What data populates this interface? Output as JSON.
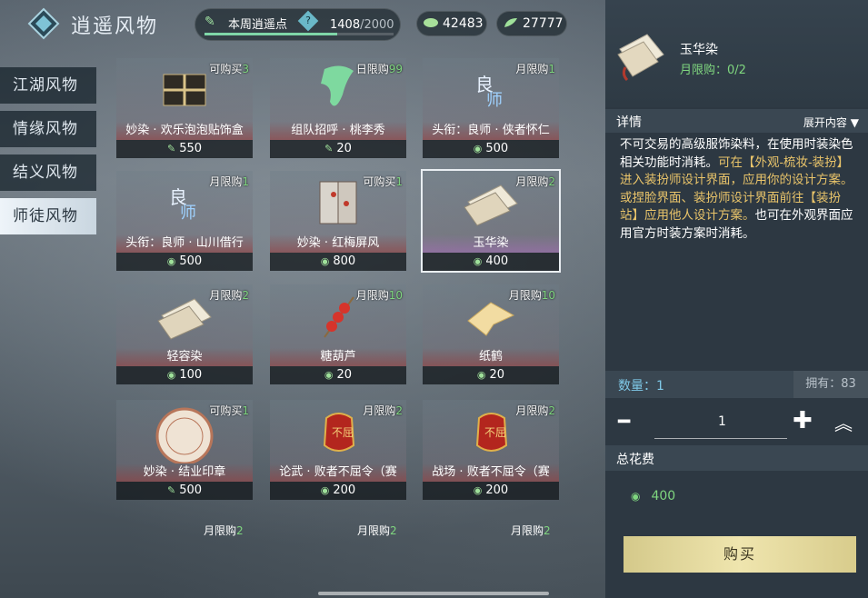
{
  "header": {
    "title": "逍遥风物",
    "weekly_label": "本周逍遥点",
    "help": "?",
    "weekly_current": "1408",
    "weekly_total": "/2000",
    "weekly_progress": 0.704,
    "currency_a": "42483",
    "currency_b": "27777"
  },
  "tabs": [
    "江湖风物",
    "情缘风物",
    "结义风物",
    "师徒风物"
  ],
  "items": [
    {
      "tag": "可购买",
      "tag_n": "3",
      "name": "妙染 · 欢乐泡泡贴饰盒",
      "price": "550"
    },
    {
      "tag": "日限购",
      "tag_n": "99",
      "name": "组队招呼 · 桃李秀",
      "price": "20"
    },
    {
      "tag": "月限购",
      "tag_n": "1",
      "name": "头衔：良师 · 侠者怀仁",
      "price": "500"
    },
    {
      "tag": "月限购",
      "tag_n": "1",
      "name": "头衔：良师 · 山川借行",
      "price": "500"
    },
    {
      "tag": "可购买",
      "tag_n": "1",
      "name": "妙染 · 红梅屏风",
      "price": "800"
    },
    {
      "tag": "月限购",
      "tag_n": "2",
      "name": "玉华染",
      "price": "400"
    },
    {
      "tag": "月限购",
      "tag_n": "2",
      "name": "轻容染",
      "price": "100"
    },
    {
      "tag": "月限购",
      "tag_n": "10",
      "name": "糖葫芦",
      "price": "20"
    },
    {
      "tag": "月限购",
      "tag_n": "10",
      "name": "纸鹤",
      "price": "20"
    },
    {
      "tag": "可购买",
      "tag_n": "1",
      "name": "妙染 · 结业印章",
      "price": "500"
    },
    {
      "tag": "月限购",
      "tag_n": "2",
      "name": "论武 · 败者不屈令（赛",
      "price": "200"
    },
    {
      "tag": "月限购",
      "tag_n": "2",
      "name": "战场 · 败者不屈令（赛",
      "price": "200"
    }
  ],
  "row4": [
    {
      "tag": "月限购",
      "tag_n": "2"
    },
    {
      "tag": "月限购",
      "tag_n": "2"
    },
    {
      "tag": "月限购",
      "tag_n": "2"
    }
  ],
  "detail": {
    "name": "玉华染",
    "limit": "月限购：0/2",
    "section_title": "详情",
    "expand": "展开内容",
    "desc_white_1": "不可交易的高级服饰染料，在使用时装染色相关功能时消耗。",
    "desc_yellow_1": "可在【外观-梳妆-装扮】进入装扮师设计界面，应用你的设计方案。",
    "desc_yellow_2": "或捏脸界面、装扮师设计界面前往【装扮站】应用他人设计方案。",
    "desc_white_2": "也可在外观界面应用官方时装方案时消耗。",
    "qty_label": "数量：1",
    "owned": "拥有：83",
    "qty_value": "1",
    "total_label": "总花费",
    "total_cost": "400",
    "buy": "购买"
  },
  "colors": {
    "accent_green": "#7fd67f",
    "warn_yellow": "#e9c46a",
    "buy_gold": "#efe5ae"
  }
}
